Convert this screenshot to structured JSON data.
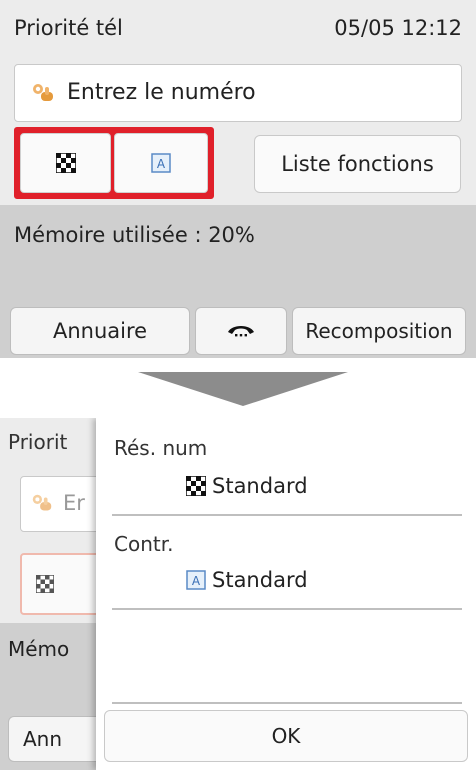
{
  "screen_before": {
    "header": {
      "title": "Priorité tél",
      "datetime": "05/05 12:12"
    },
    "number_input": {
      "placeholder": "Entrez le numéro",
      "icon": "hand-icon"
    },
    "mode_buttons": {
      "resolution_icon": "checkerboard-icon",
      "contrast_icon": "contrast-a-icon"
    },
    "function_list_label": "Liste fonctions",
    "memory_status": "Mémoire utilisée : 20%",
    "bottom_bar": {
      "directory_label": "Annuaire",
      "hook_icon": "phone-hook-icon",
      "redial_label": "Recomposition"
    }
  },
  "transition_arrow": "down-arrow-icon",
  "screen_after": {
    "background": {
      "title": "Priorit",
      "input_placeholder": "Er",
      "memory": "Mémo",
      "directory": "Ann"
    },
    "panel": {
      "resolution": {
        "label": "Rés. num",
        "value": "Standard",
        "icon": "checkerboard-icon"
      },
      "contrast": {
        "label": "Contr.",
        "value": "Standard",
        "icon": "contrast-a-icon"
      },
      "ok_label": "OK"
    }
  },
  "colors": {
    "highlight": "#e0202a",
    "screen_bg": "#ececec",
    "status_bg": "#cfcfcf",
    "hand_icon": "#e59a3c"
  }
}
